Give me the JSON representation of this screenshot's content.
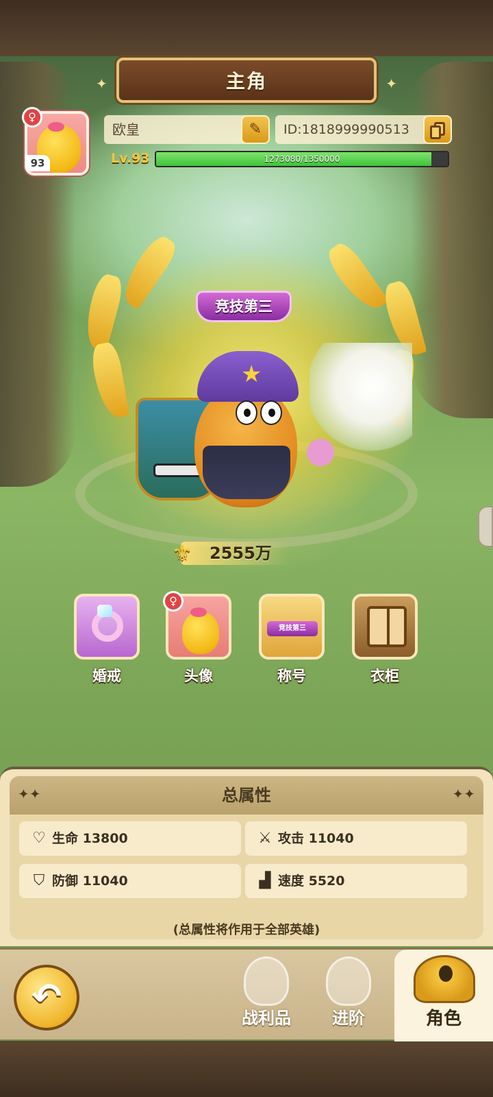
{
  "header": {
    "title": "主角"
  },
  "profile": {
    "avatar_level": "93",
    "gender_symbol": "♀",
    "name": "欧皇",
    "id_text": "ID:1818999990513",
    "level_label": "Lv.93",
    "xp_text": "1273080/1350000",
    "xp_fraction": 0.943
  },
  "hero": {
    "title_badge": "竞技第三",
    "power_value": "2555万"
  },
  "quick_actions": [
    {
      "label": "婚戒",
      "icon": "ring-icon"
    },
    {
      "label": "头像",
      "icon": "avatar-icon"
    },
    {
      "label": "称号",
      "icon": "title-icon",
      "mini_badge": "竞技第三"
    },
    {
      "label": "衣柜",
      "icon": "wardrobe-icon"
    }
  ],
  "attributes": {
    "title": "总属性",
    "stats": [
      {
        "label": "生命 13800",
        "icon": "heart-icon"
      },
      {
        "label": "攻击 11040",
        "icon": "sword-icon"
      },
      {
        "label": "防御 11040",
        "icon": "shield-icon"
      },
      {
        "label": "速度 5520",
        "icon": "boot-icon"
      }
    ],
    "note": "(总属性将作用于全部英雄)"
  },
  "nav": {
    "tabs": [
      {
        "label": "战利品",
        "icon": "loot-icon"
      },
      {
        "label": "进阶",
        "icon": "advance-icon"
      },
      {
        "label": "角色",
        "icon": "character-icon",
        "active": true
      }
    ]
  }
}
